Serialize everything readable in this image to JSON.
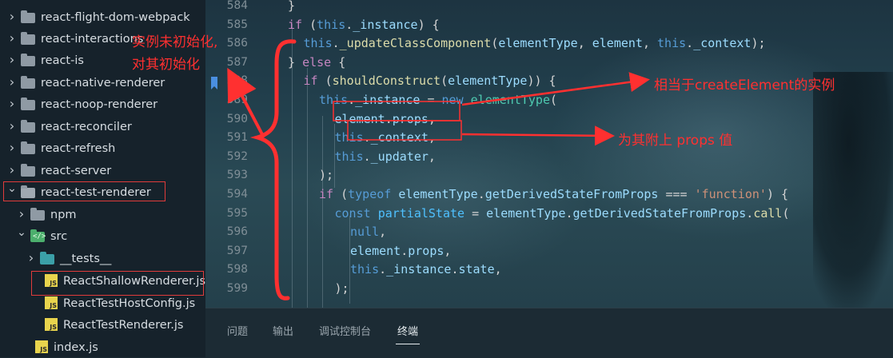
{
  "explorer": {
    "items": [
      {
        "label": "react-flight-dom-webpack",
        "kind": "folder",
        "expanded": false
      },
      {
        "label": "react-interactions",
        "kind": "folder",
        "expanded": false
      },
      {
        "label": "react-is",
        "kind": "folder",
        "expanded": false
      },
      {
        "label": "react-native-renderer",
        "kind": "folder",
        "expanded": false
      },
      {
        "label": "react-noop-renderer",
        "kind": "folder",
        "expanded": false
      },
      {
        "label": "react-reconciler",
        "kind": "folder",
        "expanded": false
      },
      {
        "label": "react-refresh",
        "kind": "folder",
        "expanded": false
      },
      {
        "label": "react-server",
        "kind": "folder",
        "expanded": false
      },
      {
        "label": "react-test-renderer",
        "kind": "folder",
        "expanded": true
      },
      {
        "label": "npm",
        "kind": "folder",
        "expanded": false
      },
      {
        "label": "src",
        "kind": "folder",
        "expanded": true
      },
      {
        "label": "__tests__",
        "kind": "folder",
        "expanded": false
      },
      {
        "label": "ReactShallowRenderer.js",
        "kind": "js"
      },
      {
        "label": "ReactTestHostConfig.js",
        "kind": "js"
      },
      {
        "label": "ReactTestRenderer.js",
        "kind": "js"
      },
      {
        "label": "index.js",
        "kind": "js"
      }
    ],
    "js_badge": "JS"
  },
  "editor": {
    "line_numbers": [
      "584",
      "585",
      "586",
      "587",
      "588",
      "589",
      "590",
      "591",
      "592",
      "593",
      "594",
      "595",
      "596",
      "597",
      "598",
      "599"
    ],
    "lines": [
      [
        {
          "t": "}",
          "c": "#d4d4d4"
        }
      ],
      [
        {
          "t": "if",
          "c": "#c586c0"
        },
        {
          "t": " (",
          "c": "#d4d4d4"
        },
        {
          "t": "this",
          "c": "#569cd6"
        },
        {
          "t": ".",
          "c": "#d4d4d4"
        },
        {
          "t": "_instance",
          "c": "#9cdcfe"
        },
        {
          "t": ") {",
          "c": "#d4d4d4"
        }
      ],
      [
        {
          "t": "this",
          "c": "#569cd6"
        },
        {
          "t": ".",
          "c": "#d4d4d4"
        },
        {
          "t": "_updateClassComponent",
          "c": "#dcdcaa"
        },
        {
          "t": "(",
          "c": "#d4d4d4"
        },
        {
          "t": "elementType",
          "c": "#9cdcfe"
        },
        {
          "t": ", ",
          "c": "#d4d4d4"
        },
        {
          "t": "element",
          "c": "#9cdcfe"
        },
        {
          "t": ", ",
          "c": "#d4d4d4"
        },
        {
          "t": "this",
          "c": "#569cd6"
        },
        {
          "t": ".",
          "c": "#d4d4d4"
        },
        {
          "t": "_context",
          "c": "#9cdcfe"
        },
        {
          "t": ");",
          "c": "#d4d4d4"
        }
      ],
      [
        {
          "t": "} ",
          "c": "#d4d4d4"
        },
        {
          "t": "else",
          "c": "#c586c0"
        },
        {
          "t": " {",
          "c": "#d4d4d4"
        }
      ],
      [
        {
          "t": "if",
          "c": "#c586c0"
        },
        {
          "t": " (",
          "c": "#d4d4d4"
        },
        {
          "t": "shouldConstruct",
          "c": "#dcdcaa"
        },
        {
          "t": "(",
          "c": "#d4d4d4"
        },
        {
          "t": "elementType",
          "c": "#9cdcfe"
        },
        {
          "t": ")) {",
          "c": "#d4d4d4"
        }
      ],
      [
        {
          "t": "this",
          "c": "#569cd6"
        },
        {
          "t": ".",
          "c": "#d4d4d4"
        },
        {
          "t": "_instance",
          "c": "#9cdcfe"
        },
        {
          "t": " = ",
          "c": "#d4d4d4"
        },
        {
          "t": "new",
          "c": "#569cd6"
        },
        {
          "t": " ",
          "c": "#d4d4d4"
        },
        {
          "t": "elementType",
          "c": "#4ec9b0"
        },
        {
          "t": "(",
          "c": "#d4d4d4"
        }
      ],
      [
        {
          "t": "element",
          "c": "#9cdcfe"
        },
        {
          "t": ".",
          "c": "#d4d4d4"
        },
        {
          "t": "props",
          "c": "#9cdcfe"
        },
        {
          "t": ",",
          "c": "#d4d4d4"
        }
      ],
      [
        {
          "t": "this",
          "c": "#569cd6"
        },
        {
          "t": ".",
          "c": "#d4d4d4"
        },
        {
          "t": "_context",
          "c": "#9cdcfe"
        },
        {
          "t": ",",
          "c": "#d4d4d4"
        }
      ],
      [
        {
          "t": "this",
          "c": "#569cd6"
        },
        {
          "t": ".",
          "c": "#d4d4d4"
        },
        {
          "t": "_updater",
          "c": "#9cdcfe"
        },
        {
          "t": ",",
          "c": "#d4d4d4"
        }
      ],
      [
        {
          "t": ");",
          "c": "#d4d4d4"
        }
      ],
      [
        {
          "t": "if",
          "c": "#c586c0"
        },
        {
          "t": " (",
          "c": "#d4d4d4"
        },
        {
          "t": "typeof",
          "c": "#569cd6"
        },
        {
          "t": " ",
          "c": "#d4d4d4"
        },
        {
          "t": "elementType",
          "c": "#9cdcfe"
        },
        {
          "t": ".",
          "c": "#d4d4d4"
        },
        {
          "t": "getDerivedStateFromProps",
          "c": "#9cdcfe"
        },
        {
          "t": " === ",
          "c": "#d4d4d4"
        },
        {
          "t": "'function'",
          "c": "#ce9178"
        },
        {
          "t": ") {",
          "c": "#d4d4d4"
        }
      ],
      [
        {
          "t": "const",
          "c": "#569cd6"
        },
        {
          "t": " ",
          "c": "#d4d4d4"
        },
        {
          "t": "partialState",
          "c": "#4fc1ff"
        },
        {
          "t": " = ",
          "c": "#d4d4d4"
        },
        {
          "t": "elementType",
          "c": "#9cdcfe"
        },
        {
          "t": ".",
          "c": "#d4d4d4"
        },
        {
          "t": "getDerivedStateFromProps",
          "c": "#9cdcfe"
        },
        {
          "t": ".",
          "c": "#d4d4d4"
        },
        {
          "t": "call",
          "c": "#dcdcaa"
        },
        {
          "t": "(",
          "c": "#d4d4d4"
        }
      ],
      [
        {
          "t": "null",
          "c": "#569cd6"
        },
        {
          "t": ",",
          "c": "#d4d4d4"
        }
      ],
      [
        {
          "t": "element",
          "c": "#9cdcfe"
        },
        {
          "t": ".",
          "c": "#d4d4d4"
        },
        {
          "t": "props",
          "c": "#9cdcfe"
        },
        {
          "t": ",",
          "c": "#d4d4d4"
        }
      ],
      [
        {
          "t": "this",
          "c": "#569cd6"
        },
        {
          "t": ".",
          "c": "#d4d4d4"
        },
        {
          "t": "_instance",
          "c": "#9cdcfe"
        },
        {
          "t": ".",
          "c": "#d4d4d4"
        },
        {
          "t": "state",
          "c": "#9cdcfe"
        },
        {
          "t": ",",
          "c": "#d4d4d4"
        }
      ],
      [
        {
          "t": ");",
          "c": "#d4d4d4"
        }
      ]
    ]
  },
  "panel": {
    "tabs": [
      "问题",
      "输出",
      "调试控制台",
      "终端"
    ],
    "active_tab": "终端"
  },
  "annotations": {
    "not_initialized_line1": "实例未初始化,",
    "not_initialized_line2": "对其初始化",
    "create_element": "相当于createElement的实例",
    "attach_props": "为其附上 props 值",
    "color": "#ff3030"
  }
}
